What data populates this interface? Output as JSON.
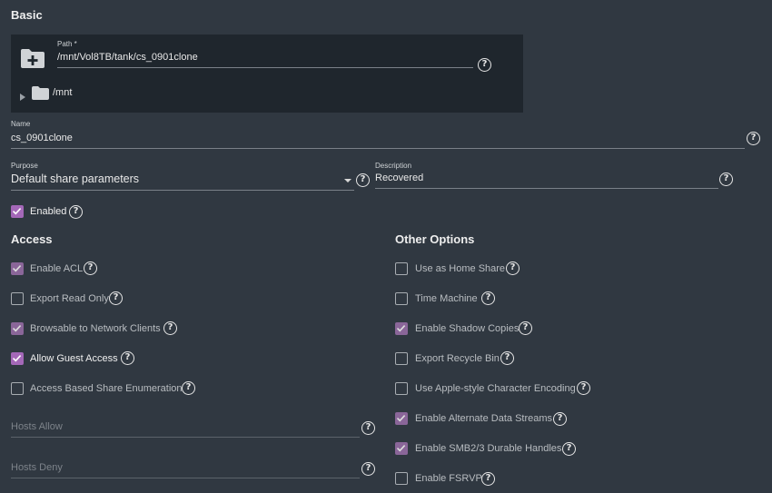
{
  "basic": {
    "title": "Basic",
    "path_label": "Path *",
    "path_value": "/mnt/Vol8TB/tank/cs_0901clone",
    "tree_root": "/mnt",
    "name_label": "Name",
    "name_value": "cs_0901clone",
    "purpose_label": "Purpose",
    "purpose_value": "Default share parameters",
    "description_label": "Description",
    "description_value": "Recovered",
    "enabled_label": "Enabled",
    "enabled_checked": true
  },
  "access": {
    "title": "Access",
    "options": [
      {
        "label": "Enable ACL",
        "checked": true
      },
      {
        "label": "Export Read Only",
        "checked": false
      },
      {
        "label": "Browsable to Network Clients",
        "checked": true
      },
      {
        "label": "Allow Guest Access",
        "checked": true
      },
      {
        "label": "Access Based Share Enumeration",
        "checked": false
      }
    ],
    "hosts_allow_placeholder": "Hosts Allow",
    "hosts_deny_placeholder": "Hosts Deny"
  },
  "other": {
    "title": "Other Options",
    "options": [
      {
        "label": "Use as Home Share",
        "checked": false
      },
      {
        "label": "Time Machine",
        "checked": false
      },
      {
        "label": "Enable Shadow Copies",
        "checked": true
      },
      {
        "label": "Export Recycle Bin",
        "checked": false
      },
      {
        "label": "Use Apple-style Character Encoding",
        "checked": false
      },
      {
        "label": "Enable Alternate Data Streams",
        "checked": true
      },
      {
        "label": "Enable SMB2/3 Durable Handles",
        "checked": true
      },
      {
        "label": "Enable FSRVP",
        "checked": false
      }
    ]
  },
  "help_glyph": "?",
  "colors": {
    "background": "#303841",
    "panel": "#1f262d",
    "accent": "#a468b8"
  }
}
